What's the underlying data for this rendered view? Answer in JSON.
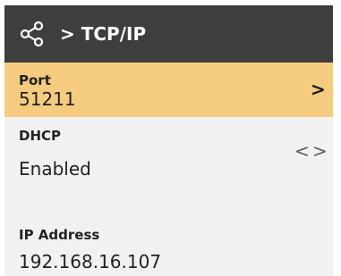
{
  "header": {
    "title": "> TCP/IP",
    "icon": "share-icon"
  },
  "rows": [
    {
      "label": "Port",
      "value": "51211",
      "selected": true,
      "control": "chevron-right-icon",
      "control_glyph": ">"
    },
    {
      "label": "DHCP",
      "value": "Enabled",
      "selected": false,
      "control": "chevron-left-right-icon",
      "left_glyph": "<",
      "right_glyph": ">"
    },
    {
      "label": "IP Address",
      "value": "192.168.16.107",
      "selected": false
    }
  ],
  "colors": {
    "header_bg": "#3e3e3e",
    "selected_bg": "#f4cb7f",
    "body_bg": "#f1f1f1",
    "text": "#222222"
  }
}
